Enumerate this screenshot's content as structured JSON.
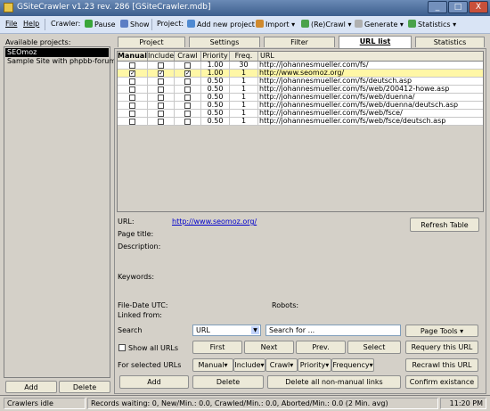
{
  "window": {
    "title": "GSiteCrawler v1.23 rev. 286 [GSiteCrawler.mdb]",
    "controls": [
      "_",
      "□",
      "X"
    ]
  },
  "menu": {
    "file": "File",
    "help": "Help",
    "crawler_label": "Crawler:",
    "pause": "Pause",
    "show": "Show",
    "project_label": "Project:",
    "add_project": "Add new project",
    "import": "Import",
    "recrawl": "(Re)Crawl",
    "generate": "Generate",
    "statistics": "Statistics"
  },
  "sidebar": {
    "label": "Available projects:",
    "projects": [
      "SEOmoz",
      "Sample Site with phpbb-forum"
    ],
    "add": "Add",
    "delete": "Delete"
  },
  "tabs": [
    "Project",
    "Settings",
    "Filter",
    "URL list",
    "Statistics"
  ],
  "table": {
    "headers": [
      "Manual",
      "Include",
      "Crawl",
      "Priority",
      "Freq.",
      "URL"
    ],
    "rows": [
      {
        "manual": false,
        "include": false,
        "crawl": false,
        "priority": "1.00",
        "freq": "30",
        "url": "http://johannesmueller.com/fs/"
      },
      {
        "manual": true,
        "include": true,
        "crawl": true,
        "priority": "1.00",
        "freq": "1",
        "url": "http://www.seomoz.org/"
      },
      {
        "manual": false,
        "include": false,
        "crawl": false,
        "priority": "0.50",
        "freq": "1",
        "url": "http://johannesmueller.com/fs/deutsch.asp"
      },
      {
        "manual": false,
        "include": false,
        "crawl": false,
        "priority": "0.50",
        "freq": "1",
        "url": "http://johannesmueller.com/fs/web/200412-howe.asp"
      },
      {
        "manual": false,
        "include": false,
        "crawl": false,
        "priority": "0.50",
        "freq": "1",
        "url": "http://johannesmueller.com/fs/web/duenna/"
      },
      {
        "manual": false,
        "include": false,
        "crawl": false,
        "priority": "0.50",
        "freq": "1",
        "url": "http://johannesmueller.com/fs/web/duenna/deutsch.asp"
      },
      {
        "manual": false,
        "include": false,
        "crawl": false,
        "priority": "0.50",
        "freq": "1",
        "url": "http://johannesmueller.com/fs/web/fsce/"
      },
      {
        "manual": false,
        "include": false,
        "crawl": false,
        "priority": "0.50",
        "freq": "1",
        "url": "http://johannesmueller.com/fs/web/fsce/deutsch.asp"
      }
    ]
  },
  "details": {
    "url_label": "URL:",
    "url_value": "http://www.seomoz.org/",
    "refresh": "Refresh Table",
    "page_title_label": "Page title:",
    "description_label": "Description:",
    "keywords_label": "Keywords:",
    "file_date_label": "File-Date UTC:",
    "robots_label": "Robots:",
    "linked_from_label": "Linked from:"
  },
  "search": {
    "label": "Search",
    "field_value": "URL",
    "placeholder": "Search for ...",
    "page_tools": "Page Tools",
    "show_all": "Show all URLs",
    "first": "First",
    "next": "Next",
    "prev": "Prev.",
    "select": "Select",
    "requery": "Requery this URL",
    "selected_label": "For selected URLs",
    "manual": "Manual",
    "include": "Include",
    "crawl": "Crawl",
    "priority": "Priority",
    "frequency": "Frequency",
    "recrawl": "Recrawl this URL",
    "add": "Add",
    "delete": "Delete",
    "delete_nonmanual": "Delete all non-manual links",
    "confirm": "Confirm existance"
  },
  "statusbar": {
    "left": "Crawlers idle",
    "middle": "Records waiting: 0, New/Min.: 0.0, Crawled/Min.: 0.0, Aborted/Min.: 0.0 (2 Min. avg)",
    "time": "11:20 PM"
  },
  "colors": {
    "highlight_row": "#fff7a6",
    "link": "#0000cc",
    "titlebar": "#4a6c9c"
  }
}
